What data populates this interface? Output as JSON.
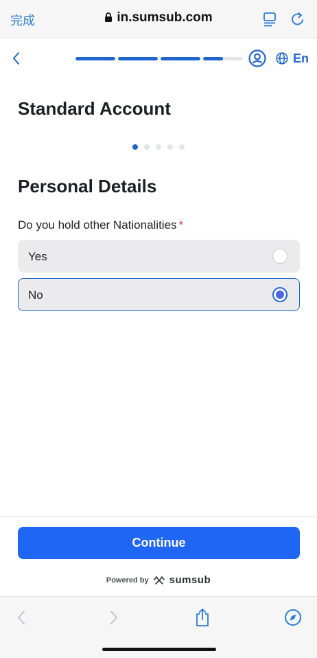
{
  "browser": {
    "done_label": "完成",
    "url": "in.sumsub.com"
  },
  "wizard": {
    "progress_segments": [
      1,
      1,
      1,
      0.5
    ],
    "language": "En"
  },
  "page": {
    "title": "Standard Account",
    "step_dots": {
      "total": 5,
      "active_index": 0
    },
    "section_title": "Personal Details",
    "question": "Do you hold other Nationalities",
    "required_marker": "*",
    "options": [
      {
        "label": "Yes",
        "selected": false
      },
      {
        "label": "No",
        "selected": true
      }
    ]
  },
  "footer": {
    "continue_label": "Continue",
    "powered_by": "Powered by",
    "brand": "sumsub"
  },
  "colors": {
    "accent": "#1f66d1",
    "button": "#1f66f5",
    "required": "#d83a3a",
    "browser_blue": "#2a7bd7"
  }
}
